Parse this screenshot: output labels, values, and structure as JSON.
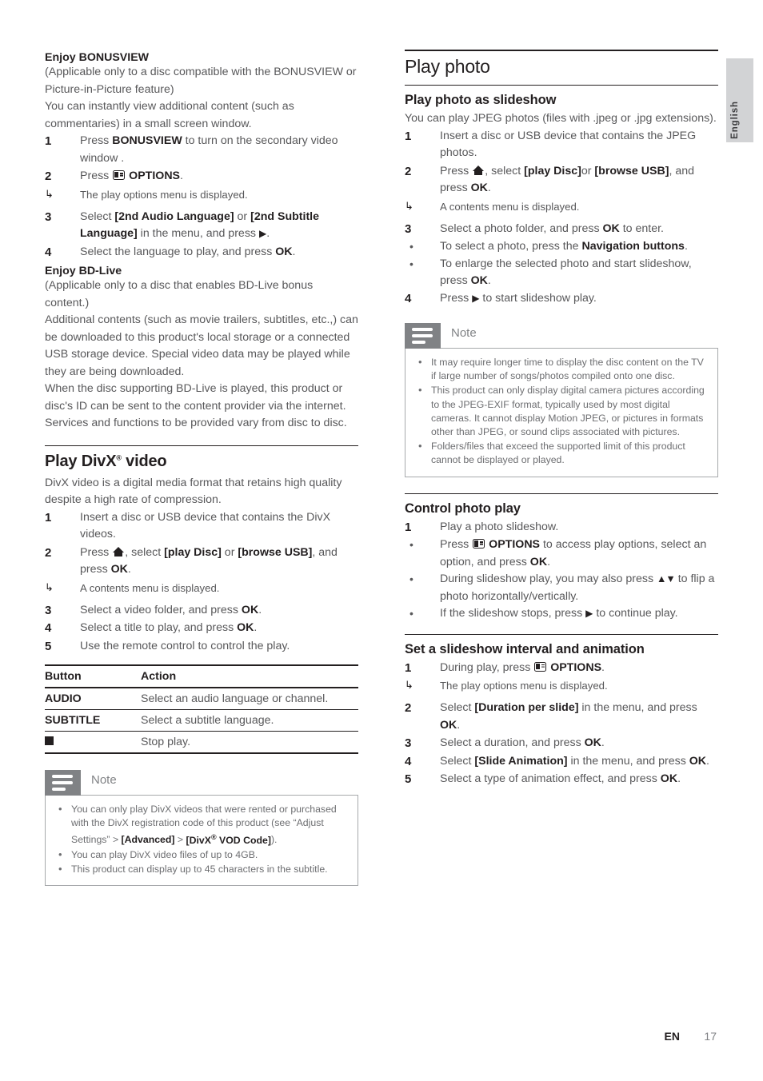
{
  "page": {
    "footer_en": "EN",
    "footer_number": "17",
    "language_tab": "English"
  },
  "left_column": {
    "bonusview": {
      "heading": "Enjoy BONUSVIEW",
      "intro": [
        "(Applicable only to a disc compatible with the BONUSVIEW or Picture-in-Picture feature)",
        "You can instantly view additional content (such as commentaries) in a small screen window."
      ],
      "steps": [
        {
          "num": "1",
          "pre": "Press ",
          "bold1": "BONUSVIEW",
          "post": " to turn on the secondary video window ."
        },
        {
          "num": "2",
          "pre": "Press ",
          "icon": "options-icon",
          "bold1": "OPTIONS",
          "post": "."
        },
        {
          "num": "3",
          "pre": "Select ",
          "bold1": "[2nd Audio Language]",
          "mid": " or ",
          "bold2": "[2nd Subtitle Language]",
          "post": " in the menu, and press "
        },
        {
          "num": "4",
          "pre": "Select the language to play, and press ",
          "bold1": "OK",
          "post": "."
        }
      ],
      "arrow_after_step2": "The play options menu is displayed."
    },
    "bdlive": {
      "heading": "Enjoy BD-Live",
      "paragraphs": [
        "(Applicable only to a disc that enables BD-Live bonus content.)",
        "Additional contents (such as movie trailers, subtitles, etc.,) can be downloaded to this product's local storage or a connected USB storage device. Special video data may be played while they are being downloaded.",
        "When the disc supporting BD-Live is played, this product or disc's ID can be sent to the content provider via the internet. Services and functions to be provided vary from disc to disc."
      ]
    },
    "divx": {
      "heading": "Play DivX",
      "heading_sup": "®",
      "heading_tail": " video",
      "intro": "DivX video is a digital media format that retains high quality despite a high rate of compression.",
      "steps": [
        {
          "num": "1",
          "text": "Insert a disc or USB device that contains the DivX videos."
        },
        {
          "num": "2",
          "pre": "Press ",
          "icon": "home-icon",
          "mid1": ", select ",
          "bold1": "[play Disc]",
          "mid2": " or ",
          "bold2": "[browse USB]",
          "mid3": ", and press ",
          "bold3": "OK",
          "post": "."
        },
        {
          "num": "3",
          "pre": "Select a video folder, and press ",
          "bold1": "OK",
          "post": "."
        },
        {
          "num": "4",
          "pre": "Select a title to play, and press ",
          "bold1": "OK",
          "post": "."
        },
        {
          "num": "5",
          "text": "Use the remote control to control the play."
        }
      ],
      "arrow_after_step2": "A contents menu is displayed."
    },
    "table": {
      "headers": [
        "Button",
        "Action"
      ],
      "rows": [
        {
          "button": "AUDIO",
          "action": "Select an audio language or channel."
        },
        {
          "button": "SUBTITLE",
          "action": "Select a subtitle language."
        },
        {
          "button": "stop-square-icon",
          "action": "Stop play."
        }
      ]
    },
    "note": {
      "title": "Note",
      "items": [
        {
          "parts": [
            "You can only play DivX videos that were rented or purchased with the DivX registration code of this product (see “Adjust Settings” > ",
            "[Advanced]",
            " > ",
            "[DivX® VOD Code]",
            ")."
          ]
        },
        {
          "plain": "You can play DivX video files of up to 4GB."
        },
        {
          "plain": "This product can display up to 45 characters in the subtitle."
        }
      ]
    }
  },
  "right_column": {
    "section_title": "Play photo",
    "slideshow": {
      "heading": "Play photo as slideshow",
      "intro": "You can play JPEG photos (files with .jpeg or .jpg extensions).",
      "steps": [
        {
          "num": "1",
          "text": "Insert a disc or USB device that contains the JPEG photos."
        },
        {
          "num": "2",
          "pre": "Press ",
          "icon": "home-icon",
          "mid1": ", select ",
          "bold1": "[play Disc]",
          "mid2": "or ",
          "bold2": "[browse USB]",
          "mid3": ", and press ",
          "bold3": "OK",
          "post": "."
        },
        {
          "num": "3",
          "pre": "Select a photo folder, and press ",
          "bold1": "OK",
          "post": " to enter."
        },
        {
          "num": "4",
          "pre": "Press ",
          "icon": "play-triangle-icon",
          "post": " to start slideshow play."
        }
      ],
      "arrow_after_step2": "A contents menu is displayed.",
      "bullets_step3": [
        {
          "pre": "To select a photo, press the ",
          "bold1": "Navigation buttons",
          "post": "."
        },
        {
          "pre": "To enlarge the selected photo and start slideshow, press ",
          "bold1": "OK",
          "post": "."
        }
      ]
    },
    "note": {
      "title": "Note",
      "items": [
        {
          "plain": "It may require longer time to display the disc content on the TV if large number of songs/photos compiled onto one disc."
        },
        {
          "plain": "This product can only display digital camera pictures according to the JPEG-EXIF format, typically used by most digital cameras. It cannot display Motion JPEG, or pictures in formats other than JPEG, or sound clips associated with pictures."
        },
        {
          "plain": "Folders/files that exceed the supported limit of this product cannot be displayed or played."
        }
      ]
    },
    "control": {
      "heading": "Control photo play",
      "step1_num": "1",
      "step1_text": "Play a photo slideshow.",
      "bullets": [
        {
          "pre": "Press ",
          "icon": "options-icon",
          "bold1": "OPTIONS",
          "mid1": " to access play options, select an option, and press ",
          "bold2": "OK",
          "post": "."
        },
        {
          "pre": "During slideshow play, you may also press ",
          "icon": "up-down-arrows-icon",
          "post": " to flip a photo horizontally/vertically."
        },
        {
          "pre": "If the slideshow stops, press ",
          "icon": "play-triangle-icon",
          "post": " to continue play."
        }
      ]
    },
    "interval": {
      "heading": "Set a slideshow interval and animation",
      "steps": [
        {
          "num": "1",
          "pre": "During play, press ",
          "icon": "options-icon",
          "bold1": "OPTIONS",
          "post": "."
        },
        {
          "num": "2",
          "pre": "Select ",
          "bold1": "[Duration per slide]",
          "mid1": " in the menu, and press ",
          "bold2": "OK",
          "post": "."
        },
        {
          "num": "3",
          "pre": "Select a duration, and press ",
          "bold1": "OK",
          "post": "."
        },
        {
          "num": "4",
          "pre": "Select ",
          "bold1": "[Slide Animation]",
          "mid1": " in the menu, and press ",
          "bold2": "OK",
          "post": "."
        },
        {
          "num": "5",
          "pre": "Select a type of animation effect, and press ",
          "bold1": "OK",
          "post": "."
        }
      ],
      "arrow_after_step1": "The play options menu is displayed."
    }
  }
}
